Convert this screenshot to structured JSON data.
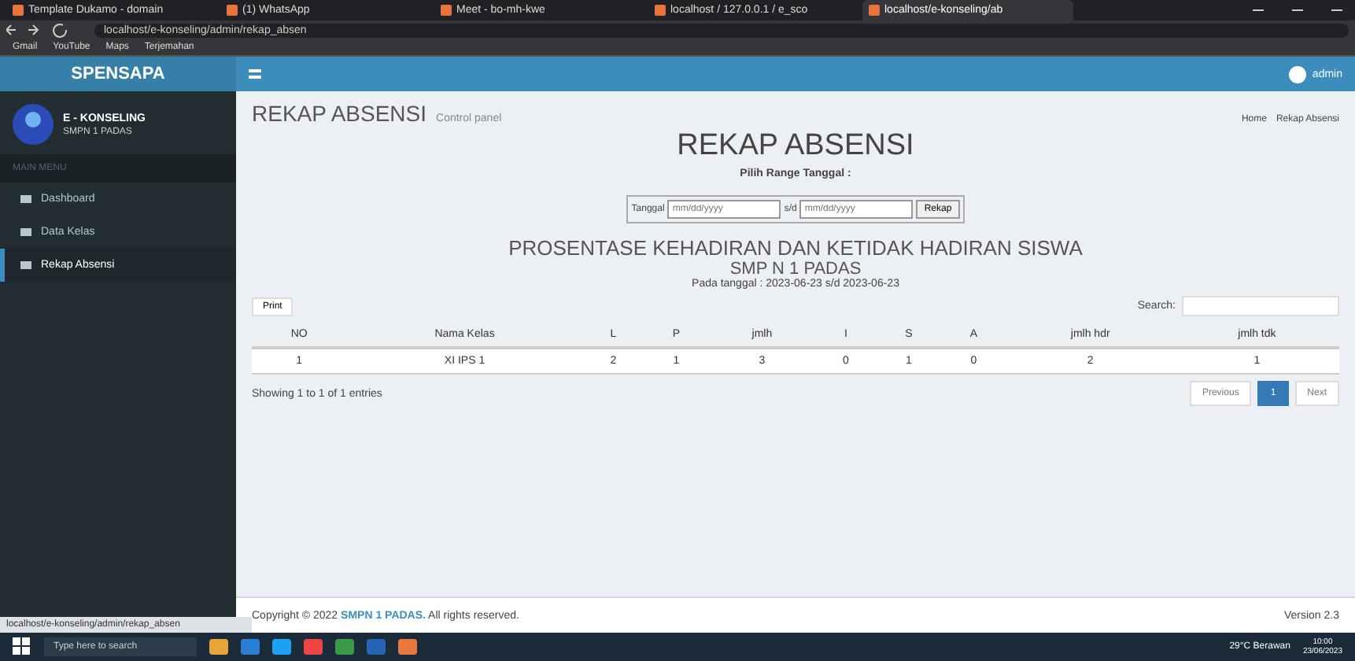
{
  "browser": {
    "tabs": [
      {
        "title": "Template Dukamo - domain",
        "selected": false
      },
      {
        "title": "(1) WhatsApp",
        "selected": false
      },
      {
        "title": "Meet - bo-mh-kwe",
        "selected": false
      },
      {
        "title": "localhost / 127.0.0.1 / e_sco",
        "selected": false
      },
      {
        "title": "localhost/e-konseling/ab",
        "selected": true
      }
    ],
    "address": "localhost/e-konseling/admin/rekap_absen",
    "bookmarks": [
      "Gmail",
      "YouTube",
      "Maps",
      "Terjemahan"
    ]
  },
  "header": {
    "brand": "SPENSAPA",
    "user": "admin"
  },
  "sidebar": {
    "title": "E - KONSELING",
    "subtitle": "SMPN 1 PADAS",
    "section": "MAIN MENU",
    "items": [
      {
        "label": "Dashboard",
        "selected": false
      },
      {
        "label": "Data Kelas",
        "selected": false
      },
      {
        "label": "Rekap Absensi",
        "selected": true
      }
    ]
  },
  "page": {
    "title": "REKAP ABSENSI",
    "subtitle": "Control panel",
    "breadcrumb": [
      "Home",
      "Rekap Absensi"
    ]
  },
  "report": {
    "heading": "REKAP ABSENSI",
    "range_label": "Pilih Range Tanggal :",
    "date_label": "Tanggal",
    "from_placeholder": "mm/dd/yyyy",
    "to_label": "s/d",
    "to_placeholder": "mm/dd/yyyy",
    "submit": "Rekap",
    "title": "PROSENTASE KEHADIRAN DAN KETIDAK HADIRAN SISWA",
    "school": "SMP N 1 PADAS",
    "period": "Pada tanggal : 2023-06-23 s/d 2023-06-23"
  },
  "table": {
    "print": "Print",
    "search_label": "Search:",
    "columns": [
      "NO",
      "Nama Kelas",
      "L",
      "P",
      "jmlh",
      "I",
      "S",
      "A",
      "jmlh hdr",
      "jmlh tdk"
    ],
    "rows": [
      [
        "1",
        "XI IPS 1",
        "2",
        "1",
        "3",
        "0",
        "1",
        "0",
        "2",
        "1"
      ]
    ],
    "info": "Showing 1 to 1 of 1 entries",
    "pages": [
      {
        "label": "Previous",
        "selected": false
      },
      {
        "label": "1",
        "selected": true
      },
      {
        "label": "Next",
        "selected": false
      }
    ]
  },
  "footer": {
    "copyright": "Copyright © 2022 ",
    "org": "SMPN 1 PADAS.",
    "rights": " All rights reserved.",
    "version": "Version 2.3"
  },
  "status_url": "localhost/e-konseling/admin/rekap_absen",
  "taskbar": {
    "search": "Type here to search",
    "weather": "29°C Berawan",
    "time": "10:00",
    "date": "23/06/2023"
  }
}
